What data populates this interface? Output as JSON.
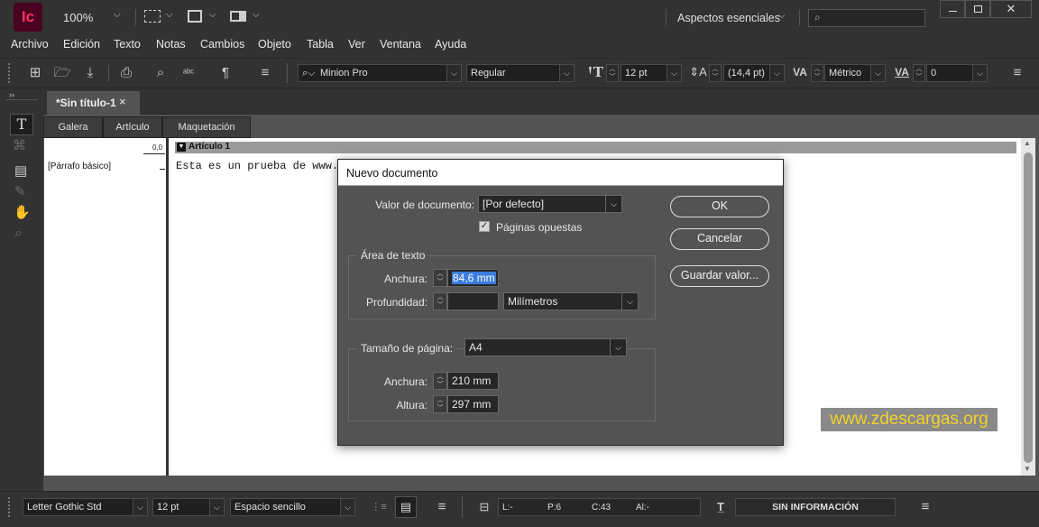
{
  "app": {
    "logo": "Ic",
    "zoom": "100%",
    "workspace": "Aspectos esenciales"
  },
  "menu": [
    "Archivo",
    "Edición",
    "Texto",
    "Notas",
    "Cambios",
    "Objeto",
    "Tabla",
    "Ver",
    "Ventana",
    "Ayuda"
  ],
  "control": {
    "font": "Minion Pro",
    "style": "Regular",
    "size": "12 pt",
    "leading": "(14,4 pt)",
    "kerning": "Métrico",
    "tracking": "0"
  },
  "document_tab": {
    "title": "*Sin título-1",
    "close": "×"
  },
  "view_tabs": [
    "Galera",
    "Artículo",
    "Maquetación"
  ],
  "story": {
    "ruler_value": "0,0",
    "style_name": "[Párrafo básico]",
    "article_label": "Artículo 1",
    "text": "Esta es un prueba de www."
  },
  "dialog": {
    "title": "Nuevo documento",
    "preset_label": "Valor de documento:",
    "preset_value": "[Por defecto]",
    "facing_pages": "Páginas opuestas",
    "text_area_title": "Área de texto",
    "width_label": "Anchura:",
    "width_value": "84,6 mm",
    "depth_label": "Profundidad:",
    "depth_value": "",
    "units_value": "Milímetros",
    "page_size_label": "Tamaño de página:",
    "page_size_value": "A4",
    "page_width_label": "Anchura:",
    "page_width_value": "210 mm",
    "page_height_label": "Altura:",
    "page_height_value": "297 mm",
    "ok": "OK",
    "cancel": "Cancelar",
    "save_preset": "Guardar valor..."
  },
  "watermark": "www.zdescargas.org",
  "status": {
    "font": "Letter Gothic Std",
    "size": "12 pt",
    "spacing": "Espacio sencillo",
    "line": "L:-",
    "page": "P:6",
    "chars": "C:43",
    "height": "Al:-",
    "info": "SIN INFORMACIÓN"
  }
}
